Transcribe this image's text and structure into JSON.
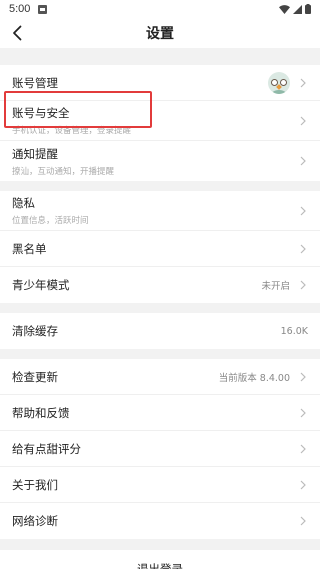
{
  "status_bar": {
    "time": "5:00"
  },
  "nav": {
    "title": "设置"
  },
  "groups": [
    {
      "items": [
        {
          "label": "账号管理"
        },
        {
          "label": "账号与安全",
          "subtitle": "手机认证，设备管理，登录提醒"
        },
        {
          "label": "通知提醒",
          "subtitle": "撩汕，互动通知，开播提醒"
        }
      ]
    },
    {
      "items": [
        {
          "label": "隐私",
          "subtitle": "位置信息，活跃时间"
        },
        {
          "label": "黑名单"
        },
        {
          "label": "青少年模式",
          "value": "未开启"
        }
      ]
    },
    {
      "items": [
        {
          "label": "清除缓存",
          "value": "16.0K"
        }
      ]
    },
    {
      "items": [
        {
          "label": "检查更新",
          "value": "当前版本 8.4.00"
        },
        {
          "label": "帮助和反馈"
        },
        {
          "label": "给有点甜评分"
        },
        {
          "label": "关于我们"
        },
        {
          "label": "网络诊断"
        }
      ]
    }
  ],
  "logout": {
    "label": "退出登录"
  },
  "colors": {
    "highlight": "#e23b3b",
    "background": "#f2f2f2"
  }
}
